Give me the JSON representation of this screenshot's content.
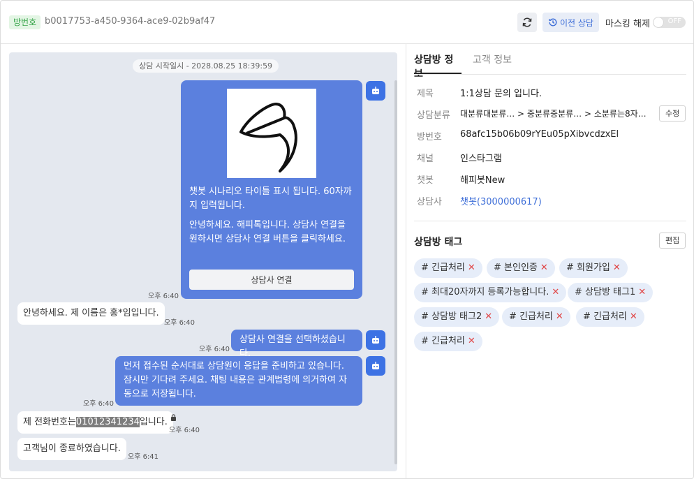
{
  "header": {
    "room_badge": "방번호",
    "room_id": "b0017753-a450-9364-ace9-02b9af47",
    "prev_chat_label": "이전 상담",
    "masking_label": "마스킹 해제",
    "toggle_state": "OFF"
  },
  "chat": {
    "start_time": "상담 시작일시 - 2028.08.25 18:39:59",
    "card": {
      "title": "챗봇 시나리오 타이틀 표시 됩니다. 60자까지 입력됩니다.",
      "body": "안녕하세요. 해피톡입니다. 상담사 연결을 원하시면 상담사 연결 버튼을 클릭하세요.",
      "button": "상담사 연결",
      "time": "오후 6:40"
    },
    "msg_user1": {
      "text": "안녕하세요. 제 이름은 홍*임입니다.",
      "time": "오후 6:40"
    },
    "msg_bot2": {
      "text": "상담사 연결을 선택하셨습니다.",
      "time": "오후 6:40"
    },
    "msg_bot3": {
      "text": "먼저 접수된 순서대로 상담원이 응답을 준비하고 있습니다. 잠시만 기다려 주세요. 채팅 내용은 관계법령에 의거하여 자동으로 저장됩니다.",
      "time": "오후 6:40"
    },
    "msg_user2": {
      "prefix": "제 전화번호는",
      "masked": "01012341234",
      "suffix": "입니다.",
      "time": "오후 6:40"
    },
    "msg_user3": {
      "text": "고객님이 종료하였습니다.",
      "time": "오후 6:41"
    }
  },
  "info": {
    "tabs": [
      "상담방 정보",
      "고객 정보"
    ],
    "rows": [
      {
        "label": "제목",
        "value": "1:1상담 문의 입니다."
      },
      {
        "label": "상담분류",
        "value": "대분류대분류… > 중분류중분류… > 소분류는8자…"
      },
      {
        "label": "방번호",
        "value": "68afc15b06b09rYEu05pXibvcdzxEl"
      },
      {
        "label": "채널",
        "value": "인스타그램"
      },
      {
        "label": "챗봇",
        "value": "해피봇New"
      },
      {
        "label": "상담사",
        "value": "챗봇(3000000617)"
      }
    ],
    "edit_category_label": "수정",
    "tags_title": "상담방 태그",
    "tags_edit_label": "편집",
    "tags": [
      "# 긴급처리",
      "# 본인인증",
      "# 회원가입",
      "# 최대20자까지 등록가능합니다.",
      "# 상담방 태그1",
      "# 상담방 태그2",
      "# 긴급처리",
      "# 긴급처리",
      "# 긴급처리"
    ]
  },
  "icons": {
    "refresh": "refresh-icon",
    "history": "history-icon",
    "bot": "bot-icon",
    "lock": "lock-icon",
    "remove": "close-icon"
  },
  "colors": {
    "bot_bubble": "#5b80de",
    "bot_avatar": "#3d72e4",
    "link": "#3f6fd8",
    "badge_bg": "#e3f5e4",
    "badge_text": "#3aa64c",
    "tag_bg": "#e6edf9",
    "tag_remove": "#e04646"
  }
}
